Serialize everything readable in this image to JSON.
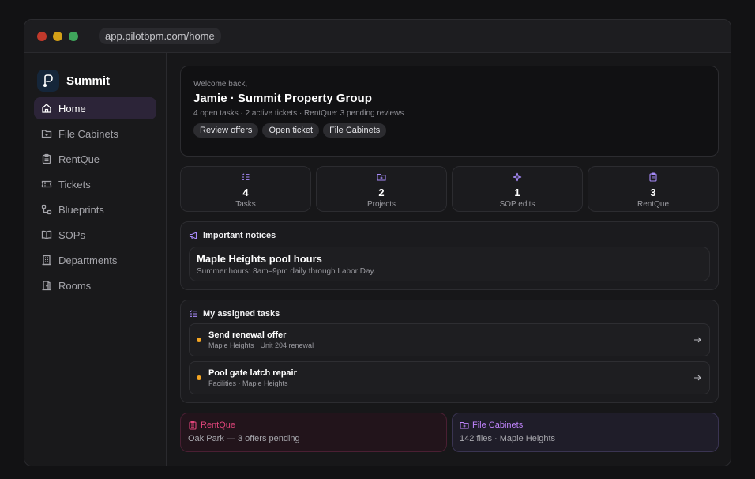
{
  "window": {
    "url": "app.pilotbpm.com/home"
  },
  "sidebar": {
    "brand": "Summit",
    "items": [
      {
        "label": "Home",
        "icon": "home-icon",
        "active": true
      },
      {
        "label": "File Cabinets",
        "icon": "folder-icon"
      },
      {
        "label": "RentQue",
        "icon": "clipboard-icon"
      },
      {
        "label": "Tickets",
        "icon": "ticket-icon"
      },
      {
        "label": "Blueprints",
        "icon": "workflow-icon"
      },
      {
        "label": "SOPs",
        "icon": "book-icon"
      },
      {
        "label": "Departments",
        "icon": "building-icon"
      },
      {
        "label": "Rooms",
        "icon": "door-icon"
      }
    ]
  },
  "hero": {
    "welcome": "Welcome back,",
    "title": "Jamie · Summit Property Group",
    "subtitle": "4 open tasks · 2 active tickets · RentQue: 3 pending reviews",
    "chips": [
      "Review offers",
      "Open ticket",
      "File Cabinets"
    ]
  },
  "stats": [
    {
      "value": "4",
      "label": "Tasks",
      "icon": "list-check-icon"
    },
    {
      "value": "2",
      "label": "Projects",
      "icon": "folder-icon"
    },
    {
      "value": "1",
      "label": "SOP edits",
      "icon": "sparkle-icon"
    },
    {
      "value": "3",
      "label": "RentQue",
      "icon": "clipboard-icon"
    }
  ],
  "notices": {
    "heading": "Important notices",
    "title": "Maple Heights pool hours",
    "body": "Summer hours: 8am–9pm daily through Labor Day."
  },
  "tasks": {
    "heading": "My assigned tasks",
    "items": [
      {
        "title": "Send renewal offer",
        "sub": "Maple Heights · Unit 204 renewal"
      },
      {
        "title": "Pool gate latch repair",
        "sub": "Facilities · Maple Heights"
      }
    ]
  },
  "shortcuts": {
    "rentque": {
      "title": "RentQue",
      "sub": "Oak Park — 3 offers pending"
    },
    "files": {
      "title": "File Cabinets",
      "sub": "142 files · Maple Heights"
    }
  },
  "colors": {
    "accent": "#a78bfa",
    "rentque": "#e0457b",
    "files": "#c084fc",
    "task_dot": "#f5a623"
  }
}
